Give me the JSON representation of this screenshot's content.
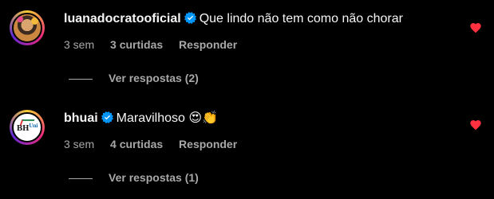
{
  "comments": [
    {
      "username": "luanadocratooficial",
      "verified": true,
      "text": "Que lindo não tem como não chorar",
      "time": "3 sem",
      "likes": "3 curtidas",
      "reply_label": "Responder",
      "view_replies": "Ver respostas (2)",
      "liked": true
    },
    {
      "username": "bhuai",
      "verified": true,
      "text": "Maravilhoso 😍👏",
      "avatar_logo": "BHUni",
      "time": "3 sem",
      "likes": "4 curtidas",
      "reply_label": "Responder",
      "view_replies": "Ver respostas (1)",
      "liked": true
    }
  ],
  "colors": {
    "background": "#000000",
    "text": "#f5f5f5",
    "secondary": "#a8a8a8",
    "verified": "#0095f6",
    "heart": "#ff3040"
  },
  "icons": {
    "verified": "verified-badge-icon",
    "like": "heart-icon"
  }
}
